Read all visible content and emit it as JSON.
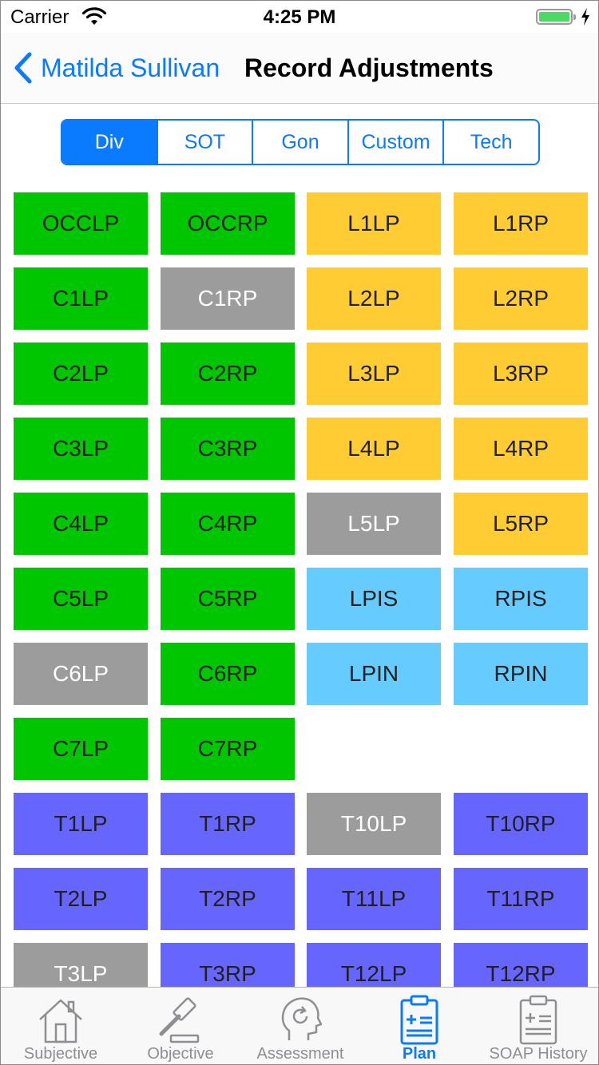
{
  "status_bar": {
    "carrier": "Carrier",
    "time": "4:25 PM"
  },
  "nav": {
    "back_label": "Matilda Sullivan",
    "title": "Record Adjustments"
  },
  "segments": {
    "options": [
      "Div",
      "SOT",
      "Gon",
      "Custom",
      "Tech"
    ],
    "selected": "Div"
  },
  "grid": {
    "tiles": [
      "OCCLP",
      "OCCRP",
      "L1LP",
      "L1RP",
      "C1LP",
      "C1RP",
      "L2LP",
      "L2RP",
      "C2LP",
      "C2RP",
      "L3LP",
      "L3RP",
      "C3LP",
      "C3RP",
      "L4LP",
      "L4RP",
      "C4LP",
      "C4RP",
      "L5LP",
      "L5RP",
      "C5LP",
      "C5RP",
      "LPIS",
      "RPIS",
      "C6LP",
      "C6RP",
      "LPIN",
      "RPIN",
      "C7LP",
      "C7RP",
      "T1LP",
      "T1RP",
      "T10LP",
      "T10RP",
      "T2LP",
      "T2RP",
      "T11LP",
      "T11RP",
      "T3LP",
      "T3RP",
      "T12LP",
      "T12RP"
    ]
  },
  "colors": {
    "green": "#00c600",
    "gray": "#9c9c9c",
    "yellow": "#ffcc33",
    "blue": "#66ccff",
    "purple": "#6666ff",
    "accent": "#0a7aff"
  },
  "tabbar": {
    "items": [
      {
        "label": "Subjective",
        "icon": "house-icon"
      },
      {
        "label": "Objective",
        "icon": "gavel-icon"
      },
      {
        "label": "Assessment",
        "icon": "head-refresh-icon"
      },
      {
        "label": "Plan",
        "icon": "clipboard-plus-icon",
        "active": true
      },
      {
        "label": "SOAP History",
        "icon": "clipboard-list-icon"
      }
    ]
  }
}
